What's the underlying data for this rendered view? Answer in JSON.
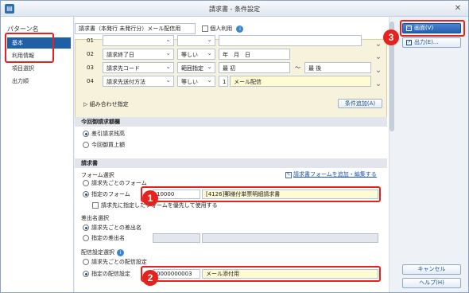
{
  "window": {
    "title": "請求書 - 条件設定",
    "close": "✕"
  },
  "left": {
    "header": "パターン名",
    "items": [
      "基本",
      "利用情報",
      "項目選択",
      "出力順"
    ]
  },
  "top": {
    "pattern_name": "請求書（本発行 未発行分）メール配信用",
    "shared_label": "個人利用"
  },
  "conditions": {
    "rows": [
      {
        "no": "01",
        "item": "",
        "op": "",
        "value": ""
      },
      {
        "no": "02",
        "item": "請求終了日",
        "op": "等しい",
        "value": "年　月　日"
      },
      {
        "no": "03",
        "item": "請求先コード",
        "op": "範囲指定",
        "value": "最 初",
        "sep": "〜",
        "value2": "最 後"
      },
      {
        "no": "04",
        "item": "請求先送付方法",
        "op": "等しい",
        "value": "1",
        "value_name": "メール配信"
      }
    ],
    "combo_label": "▷ 組み合わせ指定",
    "add_button": "条件追加(A)"
  },
  "billing_amount": {
    "header": "今回御請求額欄",
    "options": [
      "差引請求残高",
      "今回御買上額"
    ]
  },
  "invoice": {
    "header": "請求書",
    "form_select_label": "フォーム選択",
    "edit_link": "請求書フォームを追加・編集する",
    "form_opt_each": "請求先ごとのフォーム",
    "form_opt_specified": "指定のフォーム",
    "form_code": "10000",
    "form_name": "[4126]郵様付単票明細請求書",
    "form_priority": "請求先に指定したフォームを優先して使用する",
    "sender_label": "差出名選択",
    "sender_opt_each": "請求先ごとの差出名",
    "sender_opt_specified": "指定の差出名",
    "delivery_label": "配信設定選択",
    "delivery_opt_each": "請求先ごとの配信設定",
    "delivery_opt_specified": "指定の配信設定",
    "delivery_code": "0000000003",
    "delivery_name": "メール添付用"
  },
  "buttons": {
    "screen": "画面(V)",
    "output": "出力(E)...",
    "cancel": "キャンセル",
    "help": "ヘルプ(H)"
  },
  "badges": [
    "1",
    "2",
    "3"
  ],
  "colors": {
    "accent": "#1f5fa6",
    "highlight": "#e6221e",
    "field_yellow": "#fffbd2"
  }
}
